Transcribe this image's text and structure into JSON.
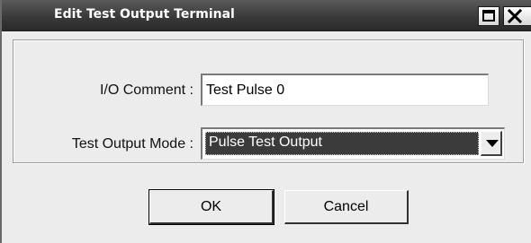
{
  "window": {
    "title": "Edit Test Output Terminal",
    "restore_icon": "restore-icon",
    "close_icon": "close-icon"
  },
  "form": {
    "io_comment": {
      "label": "I/O Comment :",
      "value": "Test Pulse 0"
    },
    "test_output_mode": {
      "label": "Test Output Mode :",
      "selected": "Pulse Test Output",
      "arrow_icon": "chevron-down-icon"
    }
  },
  "buttons": {
    "ok_label": "OK",
    "cancel_label": "Cancel"
  },
  "colors": {
    "titlebar": "#3a3a3a",
    "dialog_bg": "#ececec",
    "selection_bg": "#3b3b3b"
  }
}
